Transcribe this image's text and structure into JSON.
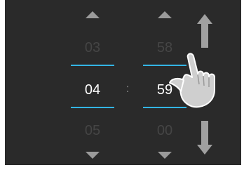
{
  "picker": {
    "hours": {
      "prev": "03",
      "current": "04",
      "next": "05"
    },
    "separator": ":",
    "minutes": {
      "prev": "58",
      "current": "59",
      "next": "00"
    }
  },
  "icons": {
    "increment": "triangle-up-icon",
    "decrement": "triangle-down-icon",
    "scroll_up": "arrow-up-icon",
    "scroll_down": "arrow-down-icon",
    "pointer": "hand-pointer-icon"
  },
  "colors": {
    "background": "#2a2a2a",
    "selection_line": "#33b5e5",
    "dim_text": "#454545",
    "active_text": "#ffffff",
    "arrow": "#9a9a9a"
  }
}
